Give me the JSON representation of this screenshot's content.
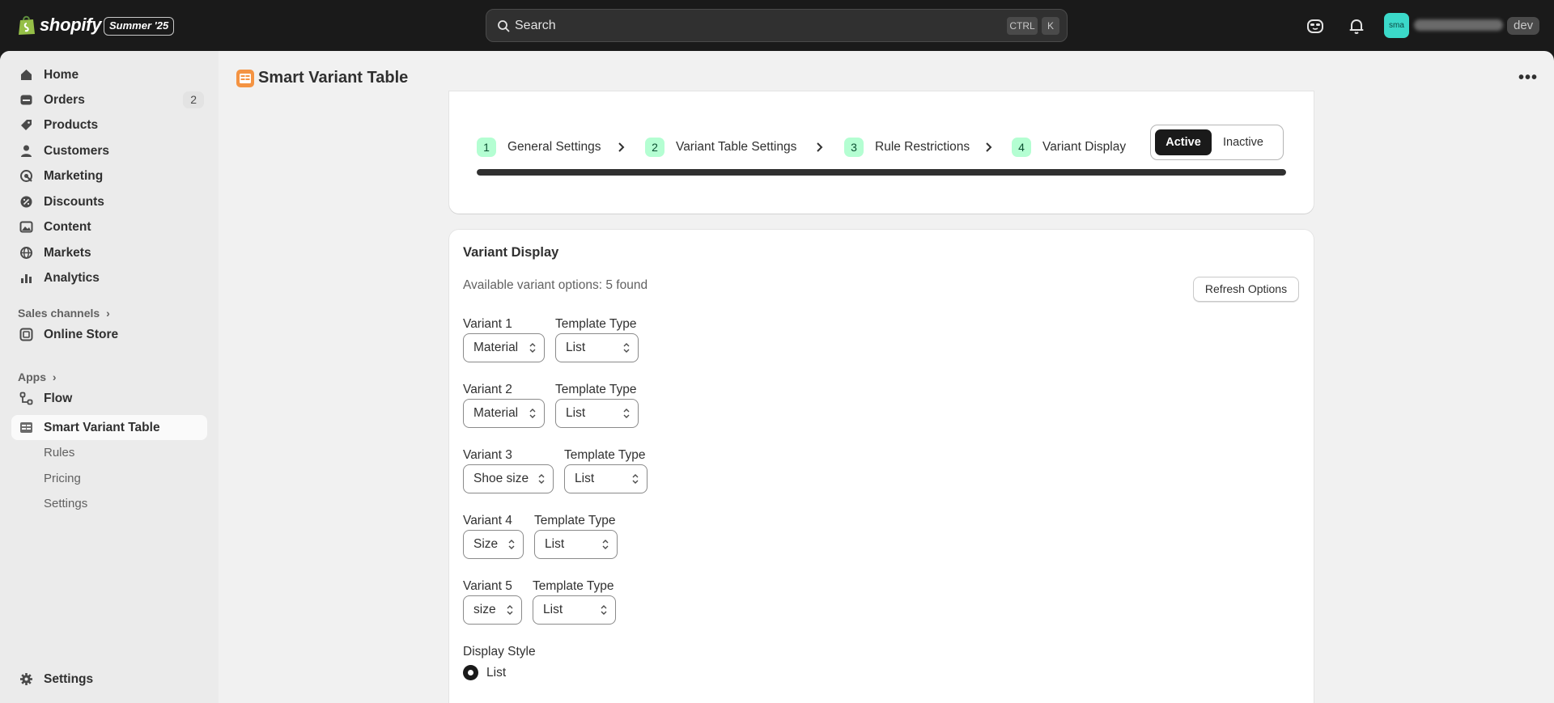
{
  "topbar": {
    "brand": "shopify",
    "edition": "Summer '25",
    "search_placeholder": "Search",
    "kbd_ctrl": "CTRL",
    "kbd_k": "K",
    "avatar_initials": "sma",
    "env_badge": "dev"
  },
  "sidebar": {
    "items": [
      {
        "label": "Home",
        "icon": "home-icon"
      },
      {
        "label": "Orders",
        "icon": "orders-icon",
        "count": "2"
      },
      {
        "label": "Products",
        "icon": "products-icon"
      },
      {
        "label": "Customers",
        "icon": "customers-icon"
      },
      {
        "label": "Marketing",
        "icon": "marketing-icon"
      },
      {
        "label": "Discounts",
        "icon": "discounts-icon"
      },
      {
        "label": "Content",
        "icon": "content-icon"
      },
      {
        "label": "Markets",
        "icon": "markets-icon"
      },
      {
        "label": "Analytics",
        "icon": "analytics-icon"
      }
    ],
    "sales_channels_label": "Sales channels",
    "online_store": "Online Store",
    "apps_label": "Apps",
    "flow": "Flow",
    "app_name": "Smart Variant Table",
    "app_subitems": [
      "Rules",
      "Pricing",
      "Settings"
    ],
    "settings": "Settings"
  },
  "page": {
    "title": "Smart Variant Table",
    "more": "•••"
  },
  "steps": {
    "items": [
      {
        "num": "1",
        "label": "General Settings"
      },
      {
        "num": "2",
        "label": "Variant Table Settings"
      },
      {
        "num": "3",
        "label": "Rule Restrictions"
      },
      {
        "num": "4",
        "label": "Variant Display"
      }
    ],
    "status_active": "Active",
    "status_inactive": "Inactive",
    "progress_fraction": 1.0
  },
  "variant_display": {
    "title": "Variant Display",
    "available_text": "Available variant options: 5 found",
    "refresh_label": "Refresh Options",
    "template_type_label": "Template Type",
    "variants": [
      {
        "label": "Variant 1",
        "value": "Material",
        "template": "List"
      },
      {
        "label": "Variant 2",
        "value": "Material",
        "template": "List"
      },
      {
        "label": "Variant 3",
        "value": "Shoe size",
        "template": "List"
      },
      {
        "label": "Variant 4",
        "value": "Size",
        "template": "List"
      },
      {
        "label": "Variant 5",
        "value": "size",
        "template": "List"
      }
    ],
    "display_style_label": "Display Style",
    "display_style_option": "List"
  },
  "colors": {
    "topbar": "#1a1a1a",
    "step_badge": "#b4fed2",
    "accent_dark": "#1a1a1a",
    "avatar": "#3bd9c9"
  }
}
